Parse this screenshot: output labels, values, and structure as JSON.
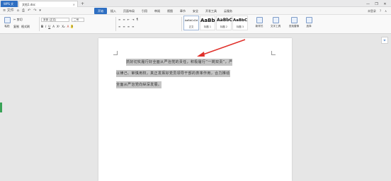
{
  "titlebar": {
    "wps_tab": "WPS 文字",
    "doc_tab": "文档1.doc",
    "close_glyph": "×",
    "new_tab": "+",
    "window": {
      "minimize": "—",
      "restore": "❐",
      "close": "✕"
    }
  },
  "quick_access": {
    "file": "≡ 文件",
    "items": [
      "⌂",
      "⎙",
      "↶",
      "↷",
      "▾"
    ]
  },
  "menu": {
    "items": [
      "开始",
      "插入",
      "页面布局",
      "引用",
      "审阅",
      "视图",
      "章节",
      "安全",
      "开发工具",
      "云服务"
    ],
    "active_index": 0,
    "right": [
      "未登录",
      "?",
      "∧"
    ]
  },
  "ribbon": {
    "paste": "粘贴",
    "cut": "✂ 剪切",
    "copy": "复制",
    "format_painter": "格式刷",
    "font_name": "宋体 (正文)",
    "font_size": "二号",
    "format_buttons": [
      "B",
      "I",
      "U",
      "A",
      "X²",
      "X₂",
      "A",
      "A"
    ],
    "para_buttons": [
      "≡",
      "≡",
      "≡",
      "≡",
      "≡",
      "⇤",
      "⇥",
      "¶"
    ],
    "styles": [
      {
        "sample": "AaBbCcDd",
        "name": "正文"
      },
      {
        "sample": "AaBb",
        "name": "标题 1"
      },
      {
        "sample": "AaBbC",
        "name": "标题 2"
      },
      {
        "sample": "AaBbC",
        "name": "标题 3"
      }
    ],
    "new_style": "新样式",
    "text_tools": "文字工具",
    "find_replace": "查找替换",
    "select": "选择"
  },
  "document": {
    "lines": [
      "抓好切实履行好全面从严治党的责任，积极履行“一岗双责”，严",
      "以律己、审慎用权，真正发挥好党员领导干部的表率作用，合力推动",
      "全面从严治党向纵深发展。"
    ]
  },
  "sidebar": {
    "location_icon": "⌖"
  }
}
